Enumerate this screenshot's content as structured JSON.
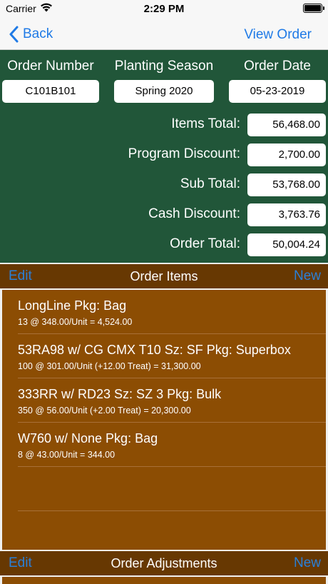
{
  "status_bar": {
    "carrier": "Carrier",
    "time": "2:29 PM"
  },
  "nav": {
    "back_label": "Back",
    "right_label": "View Order"
  },
  "order": {
    "number_label": "Order Number",
    "number_value": "C101B101",
    "season_label": "Planting Season",
    "season_value": "Spring 2020",
    "date_label": "Order Date",
    "date_value": "05-23-2019"
  },
  "totals": [
    {
      "label": "Items Total:",
      "value": "56,468.00"
    },
    {
      "label": "Program Discount:",
      "value": "2,700.00"
    },
    {
      "label": "Sub Total:",
      "value": "53,768.00"
    },
    {
      "label": "Cash Discount:",
      "value": "3,763.76"
    },
    {
      "label": "Order Total:",
      "value": "50,004.24"
    }
  ],
  "order_items_bar": {
    "edit_label": "Edit",
    "title": "Order Items",
    "new_label": "New"
  },
  "items": [
    {
      "title": "LongLine Pkg: Bag",
      "detail": "13 @ 348.00/Unit = 4,524.00"
    },
    {
      "title": "53RA98 w/ CG CMX T10 Sz: SF Pkg: Superbox",
      "detail": "100 @ 301.00/Unit (+12.00 Treat) = 31,300.00"
    },
    {
      "title": "333RR w/ RD23 Sz: SZ 3 Pkg: Bulk",
      "detail": "350 @ 56.00/Unit (+2.00 Treat) = 20,300.00"
    },
    {
      "title": "W760 w/ None Pkg: Bag",
      "detail": "8 @ 43.00/Unit = 344.00"
    }
  ],
  "adjustments_bar": {
    "edit_label": "Edit",
    "title": "Order Adjustments",
    "new_label": "New"
  },
  "colors": {
    "header_green": "#215639",
    "section_brown": "#673802",
    "list_brown": "#8c4d03",
    "link_blue": "#1f7ae6"
  }
}
